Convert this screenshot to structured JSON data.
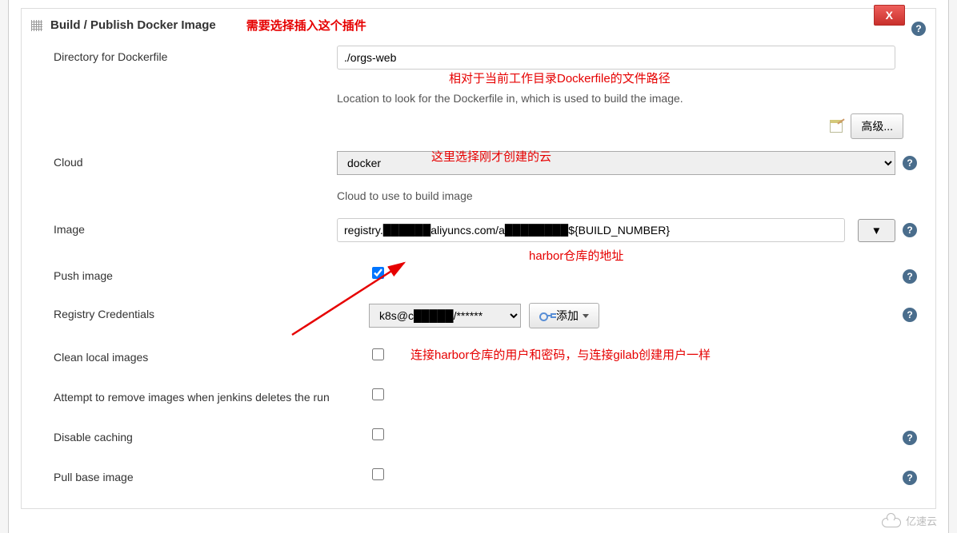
{
  "section": {
    "title": "Build / Publish Docker Image",
    "close": "X"
  },
  "annot": {
    "plugin": "需要选择插入这个插件",
    "path": "相对于当前工作目录Dockerfile的文件路径",
    "cloud": "这里选择刚才创建的云",
    "harbor": "harbor仓库的地址",
    "cred": "连接harbor仓库的用户和密码，与连接gilab创建用户一样"
  },
  "dockerfile": {
    "label": "Directory for Dockerfile",
    "value": "./orgs-web",
    "desc": "Location to look for the Dockerfile in, which is used to build the image."
  },
  "advanced": {
    "btn": "高级..."
  },
  "cloud": {
    "label": "Cloud",
    "value": "docker",
    "desc": "Cloud to use to build image"
  },
  "image": {
    "label": "Image",
    "value": "registry.██████aliyuncs.com/a████████${BUILD_NUMBER}",
    "arrow": "▼"
  },
  "push": {
    "label": "Push image"
  },
  "cred": {
    "label": "Registry Credentials",
    "value": "k8s@c█████/******",
    "addBtn": "添加"
  },
  "clean": {
    "label": "Clean local images"
  },
  "attempt": {
    "label": "Attempt to remove images when jenkins deletes the run"
  },
  "cache": {
    "label": "Disable caching"
  },
  "pull": {
    "label": "Pull base image"
  },
  "watermark": "亿速云"
}
